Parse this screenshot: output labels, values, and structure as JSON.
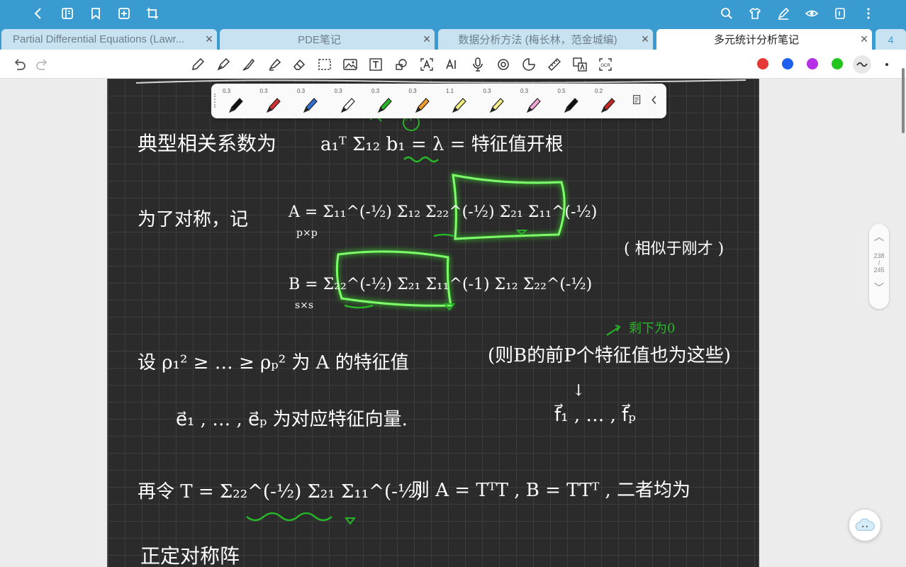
{
  "tabs": [
    {
      "label": "Partial Differential Equations (Lawr...",
      "active": false
    },
    {
      "label": "PDE笔记",
      "active": false
    },
    {
      "label": "数据分析方法 (梅长林，范金城编)",
      "active": false
    },
    {
      "label": "多元统计分析笔记",
      "active": true
    }
  ],
  "tab_overflow_count": "4",
  "toolbar_colors": [
    "#e53935",
    "#1e5ff0",
    "#b530e6",
    "#22c51d"
  ],
  "pens": [
    {
      "size": "0.3",
      "color": "#111111"
    },
    {
      "size": "0.3",
      "color": "#d32f2f"
    },
    {
      "size": "0.3",
      "color": "#2f6fd6"
    },
    {
      "size": "0.3",
      "color": "#ffffff"
    },
    {
      "size": "0.3",
      "color": "#28b428"
    },
    {
      "size": "0.3",
      "color": "#f29a2e"
    },
    {
      "size": "1.1",
      "color": "#f0ec7a"
    },
    {
      "size": "0.3",
      "color": "#f6ec8a"
    },
    {
      "size": "0.3",
      "color": "#f0a6d6"
    },
    {
      "size": "0.5",
      "color": "#111111"
    },
    {
      "size": "0.2",
      "color": "#c62828"
    }
  ],
  "pager": {
    "current": "238",
    "sep": "/",
    "total": "245"
  },
  "note": {
    "line1_lead": "典型相关系数为",
    "line1_eq": "a₁ᵀ Σ₁₂ b₁ = λ = 特征值开根",
    "line2_lead": "为了对称，记",
    "line2_eq": "A = Σ₁₁^(-½) Σ₁₂ Σ₂₂^(-½) Σ₂₁ Σ₁₁^(-½)",
    "line2_sub": "p×p",
    "line2_note": "( 相似于刚才 )",
    "line3_eq": "B = Σ₂₂^(-½) Σ₂₁ Σ₁₁^(-1) Σ₁₂ Σ₂₂^(-½)",
    "line3_sub": "s×s",
    "line4_eq": "设 ρ₁² ≥ … ≥ ρₚ² 为 A 的特征值",
    "line4_note": "(则B的前P个特征值也为这些)",
    "line4_green": "剩下为0",
    "line5_eq": "e⃗₁ , … , e⃗ₚ 为对应特征向量.",
    "line5_right": "f⃗₁ , … , f⃗ₚ",
    "line5_arrow": "↓",
    "line6_eq": "再令 T = Σ₂₂^(-½) Σ₂₁ Σ₁₁^(-½)",
    "line6_right": "则 A = TᵀT ,  B = TTᵀ , 二者均为",
    "line7_eq": "正定对称阵",
    "circle_mark": "A"
  }
}
